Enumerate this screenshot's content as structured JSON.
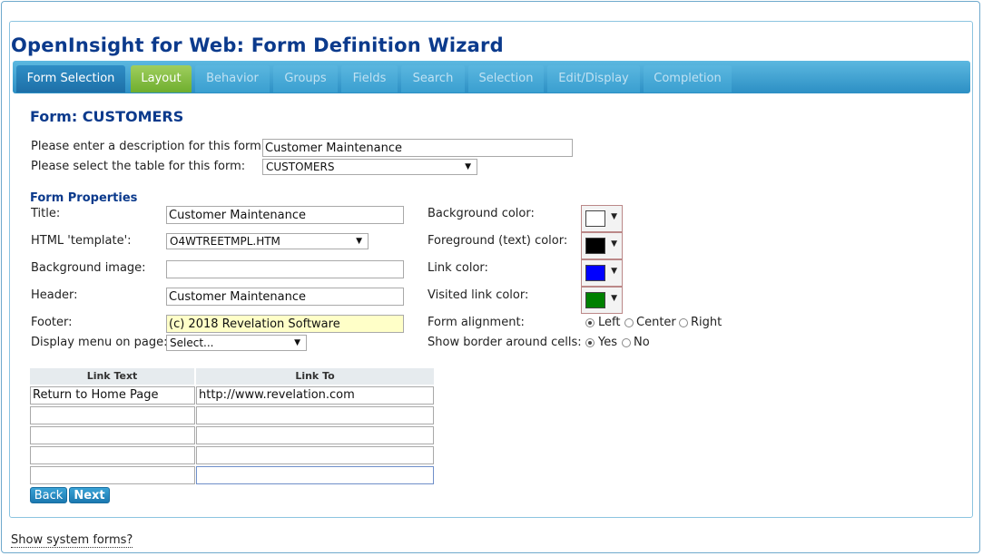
{
  "app_title": "OpenInsight for Web: Form Definition Wizard",
  "tabs": [
    {
      "label": "Form Selection"
    },
    {
      "label": "Layout"
    },
    {
      "label": "Behavior"
    },
    {
      "label": "Groups"
    },
    {
      "label": "Fields"
    },
    {
      "label": "Search"
    },
    {
      "label": "Selection"
    },
    {
      "label": "Edit/Display"
    },
    {
      "label": "Completion"
    }
  ],
  "form_heading": "Form: CUSTOMERS",
  "description": {
    "label": "Please enter a description for this form:",
    "value": "Customer Maintenance"
  },
  "table": {
    "label": "Please select the table for this form:",
    "value": "CUSTOMERS"
  },
  "properties": {
    "section_title": "Form Properties",
    "title": {
      "label": "Title:",
      "value": "Customer Maintenance"
    },
    "template": {
      "label": "HTML 'template':",
      "value": "O4WTREETMPL.HTM"
    },
    "bg_image": {
      "label": "Background image:",
      "value": ""
    },
    "header": {
      "label": "Header:",
      "value": "Customer Maintenance"
    },
    "footer": {
      "label": "Footer:",
      "value": "(c) 2018 Revelation Software"
    },
    "menu": {
      "label": "Display menu on page:",
      "value": "Select..."
    },
    "bg_color": {
      "label": "Background color:",
      "color": "#ffffff"
    },
    "fg_color": {
      "label": "Foreground (text) color:",
      "color": "#000000"
    },
    "link_color": {
      "label": "Link color:",
      "color": "#0000ff"
    },
    "visited_color": {
      "label": "Visited link color:",
      "color": "#008000"
    },
    "alignment": {
      "label": "Form alignment:",
      "options": [
        "Left",
        "Center",
        "Right"
      ],
      "selected": "Left"
    },
    "border": {
      "label": "Show border around cells:",
      "options": [
        "Yes",
        "No"
      ],
      "selected": "Yes"
    }
  },
  "links": {
    "headers": [
      "Link Text",
      "Link To"
    ],
    "rows": [
      [
        "Return to Home Page",
        "http://www.revelation.com"
      ],
      [
        "",
        ""
      ],
      [
        "",
        ""
      ],
      [
        "",
        ""
      ],
      [
        "",
        ""
      ]
    ]
  },
  "buttons": {
    "back": "Back",
    "next": "Next"
  },
  "footer_link": "Show system forms?"
}
